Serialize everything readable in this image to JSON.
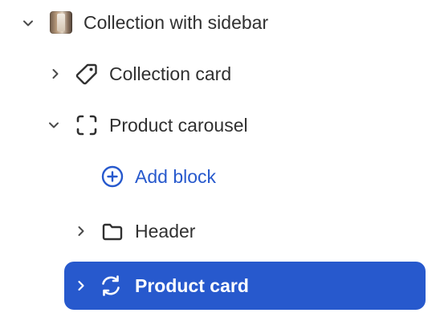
{
  "tree": {
    "root": {
      "label": "Collection with sidebar",
      "icon": "collection-thumbnail",
      "expanded": true
    },
    "items": [
      {
        "label": "Collection card",
        "icon": "tag-icon",
        "expanded": false
      },
      {
        "label": "Product carousel",
        "icon": "dashed-square-icon",
        "expanded": true
      },
      {
        "label": "Add block",
        "icon": "plus-circle-icon"
      },
      {
        "label": "Header",
        "icon": "folder-icon",
        "expanded": false
      },
      {
        "label": "Product card",
        "icon": "refresh-icon",
        "expanded": false,
        "selected": true
      }
    ]
  },
  "colors": {
    "text": "#303030",
    "accent": "#2759cd",
    "selected_text": "#ffffff",
    "icon": "#303030"
  }
}
